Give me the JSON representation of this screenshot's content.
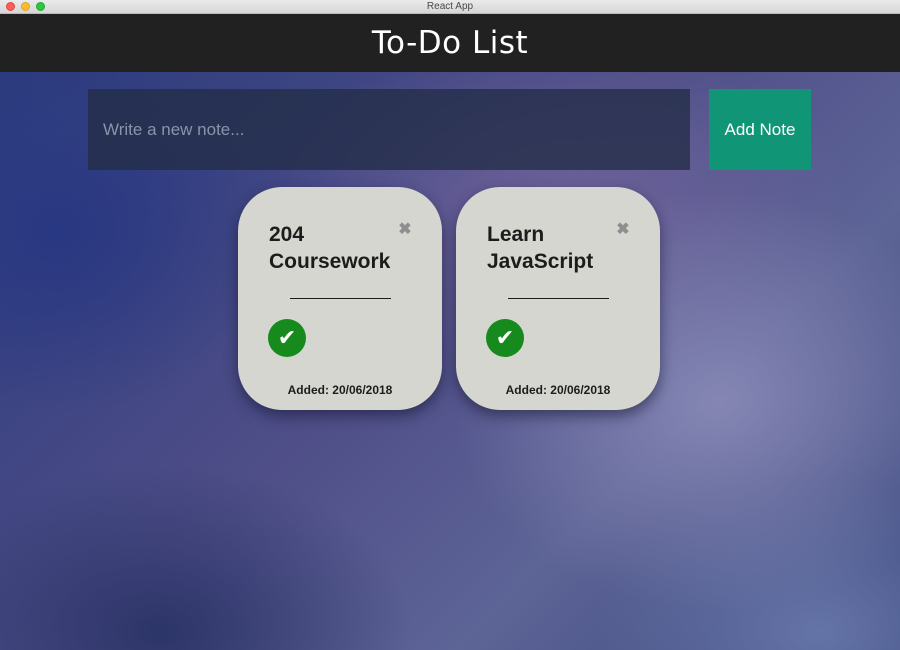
{
  "window": {
    "title": "React App"
  },
  "header": {
    "title": "To-Do List"
  },
  "input": {
    "placeholder": "Write a new note...",
    "value": ""
  },
  "add_button": {
    "label": "Add Note",
    "color": "#109676"
  },
  "notes": [
    {
      "text": "204 Coursework",
      "close_glyph": "✖",
      "check_glyph": "✔",
      "date": "Added: 20/06/2018"
    },
    {
      "text": "Learn JavaScript",
      "close_glyph": "✖",
      "check_glyph": "✔",
      "date": "Added: 20/06/2018"
    }
  ],
  "icons": {
    "close": "close-icon",
    "check": "check-icon"
  },
  "colors": {
    "header_bg": "#212121",
    "card_bg": "#d6d6d1",
    "check_bg": "#168a1c"
  }
}
